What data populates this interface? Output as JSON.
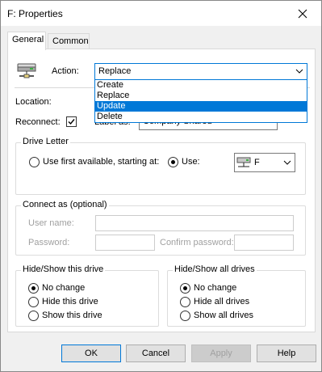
{
  "window": {
    "title": "F: Properties"
  },
  "tabs": [
    {
      "label": "General",
      "active": true
    },
    {
      "label": "Common",
      "active": false
    }
  ],
  "action": {
    "label": "Action:",
    "value": "Replace",
    "options": [
      "Create",
      "Replace",
      "Update",
      "Delete"
    ],
    "highlighted": "Update"
  },
  "location": {
    "label": "Location:"
  },
  "reconnect": {
    "label": "Reconnect:",
    "checked": true
  },
  "label_as": {
    "label": "Label as:",
    "value": "Company Shared"
  },
  "drive_letter": {
    "legend": "Drive Letter",
    "use_first_label": "Use first available, starting at:",
    "use_label": "Use:",
    "selected": "use",
    "drive_value": "F"
  },
  "connect_as": {
    "legend": "Connect as (optional)",
    "username_label": "User name:",
    "password_label": "Password:",
    "confirm_label": "Confirm password:"
  },
  "hide_show_drive": {
    "legend": "Hide/Show this drive",
    "options": [
      "No change",
      "Hide this drive",
      "Show this drive"
    ],
    "selected": "No change"
  },
  "hide_show_all": {
    "legend": "Hide/Show all drives",
    "options": [
      "No change",
      "Hide all drives",
      "Show all drives"
    ],
    "selected": "No change"
  },
  "buttons": {
    "ok": "OK",
    "cancel": "Cancel",
    "apply": "Apply",
    "help": "Help"
  },
  "icons": {
    "close": "close-icon",
    "drive": "network-drive-icon",
    "chevron": "chevron-down-icon"
  }
}
